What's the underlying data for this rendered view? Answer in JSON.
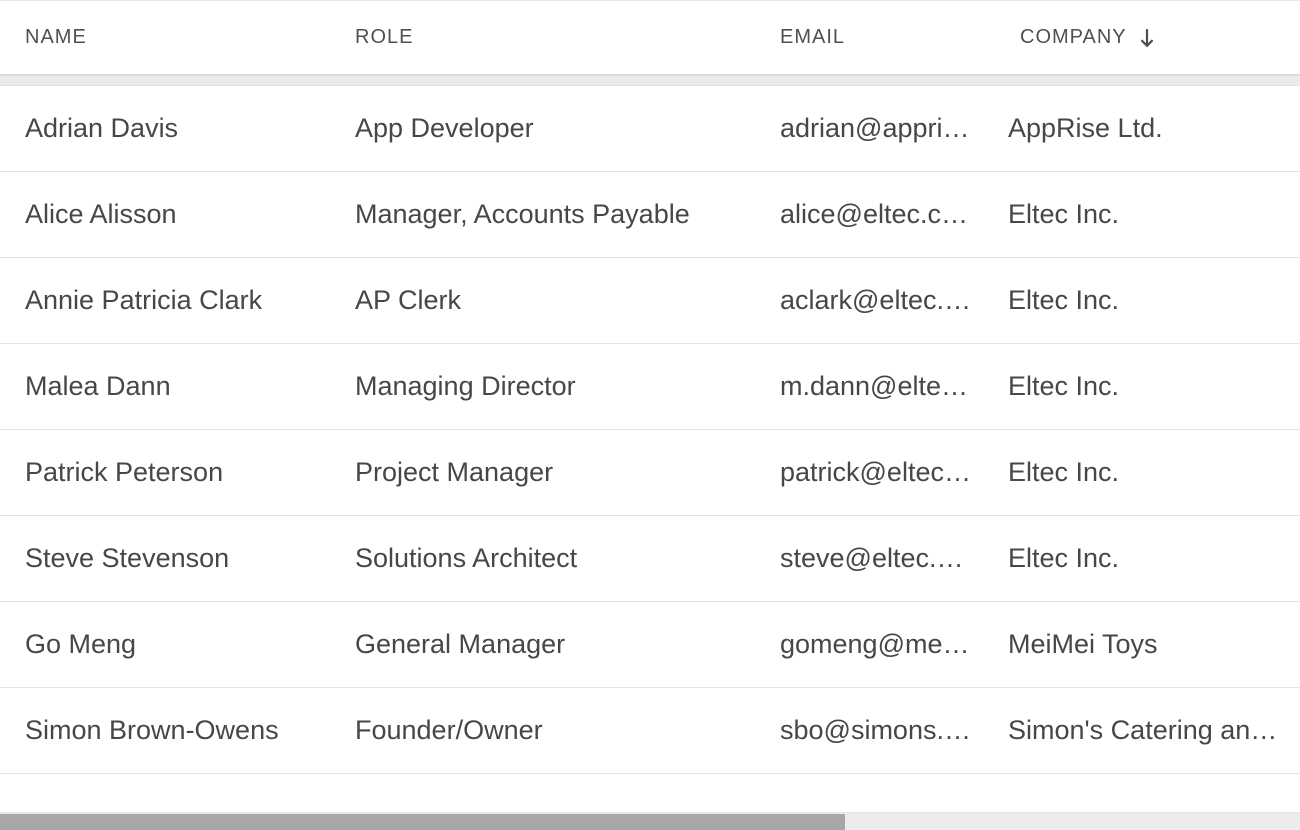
{
  "table": {
    "headers": {
      "name": "Name",
      "role": "Role",
      "email": "Email",
      "company": "Company"
    },
    "sort": {
      "column": "company",
      "direction": "asc"
    },
    "rows": [
      {
        "name": "Adrian Davis",
        "role": "App Developer",
        "email": "adrian@apprise.example",
        "company": "AppRise Ltd."
      },
      {
        "name": "Alice Alisson",
        "role": "Manager, Accounts Payable",
        "email": "alice@eltec.com",
        "company": "Eltec Inc."
      },
      {
        "name": "Annie Patricia Clark",
        "role": "AP Clerk",
        "email": "aclark@eltec.com",
        "company": "Eltec Inc."
      },
      {
        "name": "Malea Dann",
        "role": "Managing Director",
        "email": "m.dann@eltec.com",
        "company": "Eltec Inc."
      },
      {
        "name": "Patrick Peterson",
        "role": "Project Manager",
        "email": "patrick@eltec.com",
        "company": "Eltec Inc."
      },
      {
        "name": "Steve Stevenson",
        "role": "Solutions Architect",
        "email": "steve@eltec.com",
        "company": "Eltec Inc."
      },
      {
        "name": "Go Meng",
        "role": "General Manager",
        "email": "gomeng@meitoys.example",
        "company": "MeiMei Toys"
      },
      {
        "name": "Simon Brown-Owens",
        "role": "Founder/Owner",
        "email": "sbo@simons.example",
        "company": "Simon's Catering and Co."
      }
    ]
  }
}
